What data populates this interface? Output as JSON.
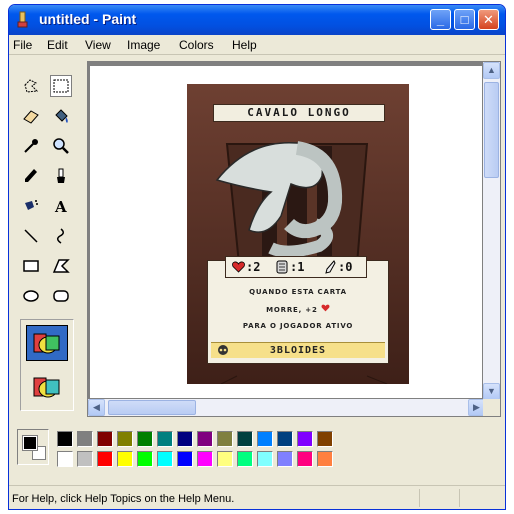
{
  "window": {
    "title": "untitled - Paint"
  },
  "menu": [
    "File",
    "Edit",
    "View",
    "Image",
    "Colors",
    "Help"
  ],
  "tools": [
    "free-form-select-icon",
    "select-icon",
    "eraser-icon",
    "fill-icon",
    "pick-color-icon",
    "magnifier-icon",
    "pencil-icon",
    "brush-icon",
    "airbrush-icon",
    "text-icon",
    "line-icon",
    "curve-icon",
    "rectangle-icon",
    "polygon-icon",
    "ellipse-icon",
    "rounded-rectangle-icon"
  ],
  "card": {
    "title": "CAVALO LONGO",
    "stats": {
      "hearts": ":2",
      "armor": ":1",
      "damage": ":0"
    },
    "text_lines": [
      "QUANDO ESTA CARTA",
      "MORRE, +2",
      "PARA O JOGADOR ATIVO"
    ],
    "faction": "3BLOIDES"
  },
  "palette": {
    "row1": [
      "#000000",
      "#808080",
      "#800000",
      "#808000",
      "#008000",
      "#008080",
      "#000080",
      "#800080",
      "#808040",
      "#004040",
      "#0080ff",
      "#004080",
      "#8000ff",
      "#804000"
    ],
    "row2": [
      "#ffffff",
      "#c0c0c0",
      "#ff0000",
      "#ffff00",
      "#00ff00",
      "#00ffff",
      "#0000ff",
      "#ff00ff",
      "#ffff80",
      "#00ff80",
      "#80ffff",
      "#8080ff",
      "#ff0080",
      "#ff8040"
    ]
  },
  "status": {
    "text": "For Help, click Help Topics on the Help Menu."
  }
}
